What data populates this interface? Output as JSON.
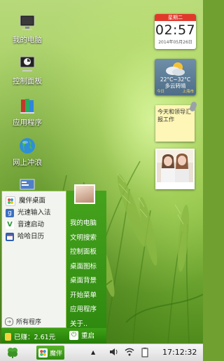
{
  "desktop": {
    "icons": [
      {
        "name": "computer-icon",
        "label": "我的电脑"
      },
      {
        "name": "control-panel-icon",
        "label": "控制面板"
      },
      {
        "name": "applications-icon",
        "label": "应用程序"
      },
      {
        "name": "internet-icon",
        "label": "网上冲浪"
      }
    ]
  },
  "widgets": {
    "clock": {
      "weekday": "星期二",
      "time": "02:57",
      "date": "2014年05月26日"
    },
    "weather": {
      "temp": "22°C~32°C",
      "condition": "多云转晴",
      "today": "今日",
      "city": "上海市"
    },
    "note": {
      "text": "今天和领导汇报工作"
    }
  },
  "start_menu": {
    "apps": [
      {
        "label": "魔伴桌面",
        "color": "#2a8ad4"
      },
      {
        "label": "光速输入法",
        "color": "#3b6fc2"
      },
      {
        "label": "音速启动",
        "color": "#2f9a3a"
      },
      {
        "label": "哈哈日历",
        "color": "#2e5fb5"
      }
    ],
    "all_programs": "所有程序",
    "system_items": [
      "我的电脑",
      "文明搜索",
      "控制面板",
      "桌面图标",
      "桌面背景",
      "开始菜单",
      "应用程序",
      "关于.."
    ],
    "earned": "已赚：2.61元",
    "restart": "重启"
  },
  "taskbar": {
    "app_label": "魔伴",
    "time": "17:12:32"
  },
  "colors": {
    "menu_green": "#3da016",
    "clock_red": "#e0392c"
  }
}
